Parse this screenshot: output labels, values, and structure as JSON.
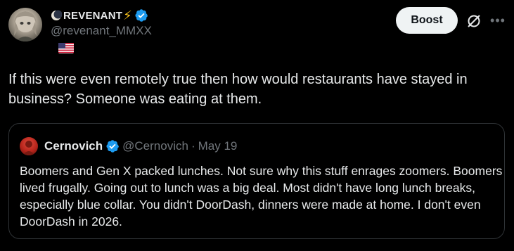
{
  "post": {
    "author": {
      "display_name": "REVENANT",
      "handle": "@revenant_MMXX",
      "verified": true,
      "moon_icon": "crescent-moon-icon",
      "bolt_glyph": "⚡",
      "flag_icon": "us-flag-icon"
    },
    "boost_label": "Boost",
    "text": "If this were even remotely true then how would restaurants have stayed in business? Someone was eating at them."
  },
  "quote": {
    "display_name": "Cernovich",
    "handle": "@Cernovich",
    "separator": "·",
    "date": "May 19",
    "verified": true,
    "text": "Boomers and Gen X packed lunches. Not sure why this stuff enrages zoomers. Boomers lived frugally. Going out to lunch was a big deal. Most didn't have long lunch breaks, especially blue collar. You didn't DoorDash, dinners were made at home. I don't even DoorDash in 2026."
  },
  "colors": {
    "background": "#000000",
    "text": "#e7e9ea",
    "secondary_text": "#71767b",
    "verified_blue": "#1d9bf0",
    "border": "#2f3336",
    "button_bg": "#eff3f4"
  }
}
